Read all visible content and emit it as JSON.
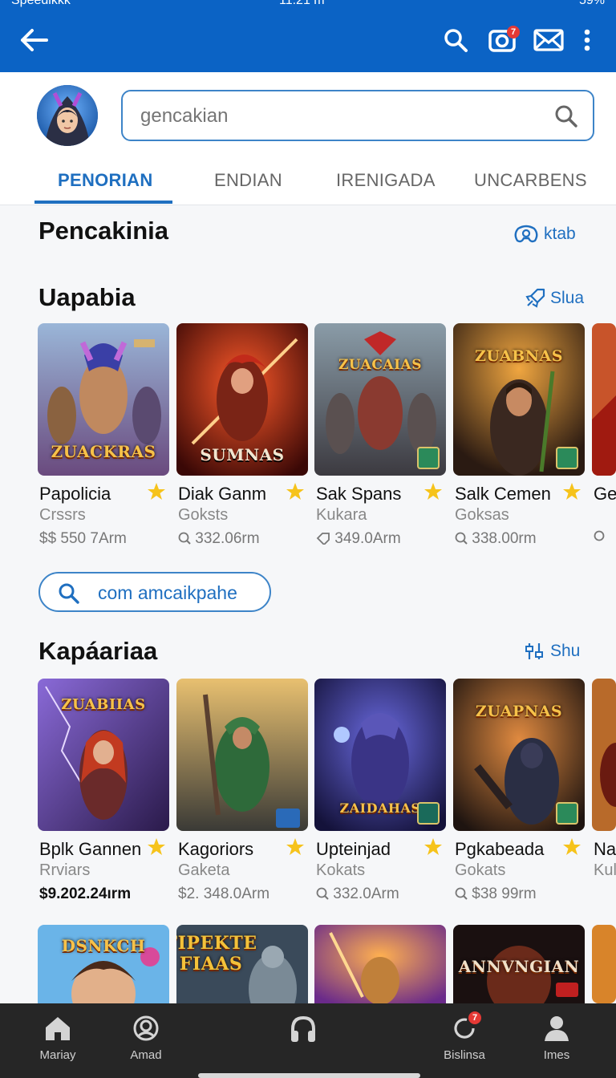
{
  "status_bar": {
    "left": "Speedikkk",
    "center": "11:21 m",
    "right": "59%"
  },
  "appbar": {
    "mail_badge": "7"
  },
  "search": {
    "placeholder": "gencakian"
  },
  "tabs": [
    "PENORIAN",
    "ENDIAN",
    "IRENIGADA",
    "UNCARBENS"
  ],
  "section1": {
    "title": "Pencakinia",
    "link": "ktab"
  },
  "section2": {
    "title": "Uapabia",
    "link": "Slua",
    "cards": [
      {
        "name": "Papolicia",
        "sub": "Crssrs",
        "meta": "$$ 550 7Arm",
        "art": "ZUACKRAS"
      },
      {
        "name": "Diak Ganm",
        "sub": "Goksts",
        "meta": "332.06rm",
        "art": "SUMNAS"
      },
      {
        "name": "Sak Spans",
        "sub": "Kukara",
        "meta": "349.0Arm",
        "art": "ZUACAIAS"
      },
      {
        "name": "Salk Cemen",
        "sub": "Goksas",
        "meta": "338.00rm",
        "art": "ZUABNAS"
      },
      {
        "name": "Ge",
        "sub": "",
        "meta": ""
      }
    ]
  },
  "pill": {
    "label": "com amcaikpahe"
  },
  "section3": {
    "title": "Kapáariaa",
    "link": "Shu",
    "cards": [
      {
        "name": "Bplk Gannen",
        "sub": "Rrviars",
        "meta": "$9.202.24ırm",
        "art": "ZUABIIAS"
      },
      {
        "name": "Kagoriors",
        "sub": "Gaketa",
        "meta": "$2. 348.0Arm",
        "art": ""
      },
      {
        "name": "Upteinjad",
        "sub": "Kokats",
        "meta": "332.0Arm",
        "art": "ZAIDAHAS"
      },
      {
        "name": "Pgkabeada",
        "sub": "Gokats",
        "meta": "$38 99rm",
        "art": "ZUAPNAS"
      },
      {
        "name": "Na",
        "sub": "Kul",
        "meta": ""
      }
    ]
  },
  "section4": {
    "cards": [
      {
        "art": "DSNKCH"
      },
      {
        "art": "FIPEKTE FIAAS"
      },
      {
        "art": ""
      },
      {
        "art": "ANNVNGIAN"
      }
    ]
  },
  "bottom_nav": [
    {
      "label": "Mariay",
      "icon": "home-icon"
    },
    {
      "label": "Amad",
      "icon": "account-circle-icon"
    },
    {
      "label": "",
      "icon": "headphones-icon"
    },
    {
      "label": "Bislinsa",
      "icon": "refresh-icon",
      "badge": "7"
    },
    {
      "label": "Imes",
      "icon": "person-icon"
    }
  ]
}
